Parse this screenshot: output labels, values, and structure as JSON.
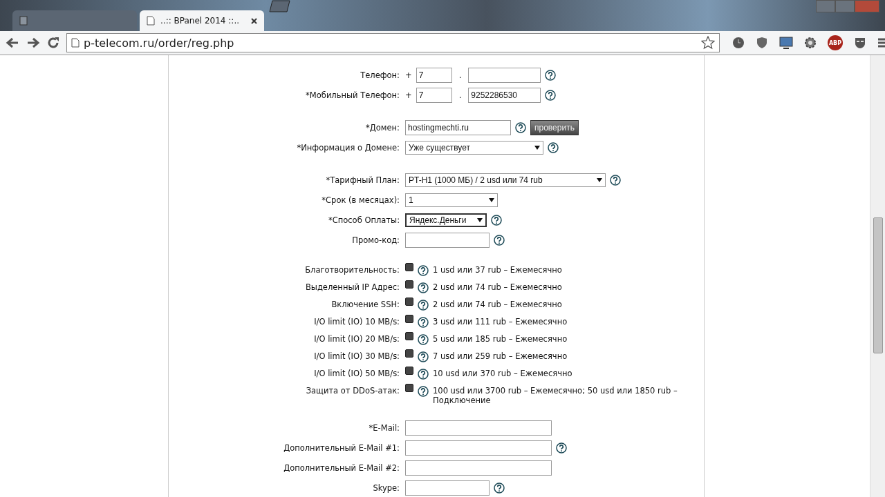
{
  "browser": {
    "tabs": [
      {
        "selected": false
      },
      {
        "title": "..:: BPanel 2014 ::..",
        "selected": true
      }
    ],
    "address": "p-telecom.ru/order/reg.php",
    "bookmarked": false,
    "adblock_label": "ABP"
  },
  "form": {
    "groups": [
      [
        {
          "kind": "phone",
          "label": "Телефон:",
          "prefix": "+",
          "code": "7",
          "separator": ".",
          "help": true
        },
        {
          "kind": "phone",
          "label": "*Мобильный Телефон:",
          "prefix": "+",
          "code": "7",
          "separator": ".",
          "number": "9252286530",
          "help": true
        }
      ],
      [
        {
          "kind": "text_button",
          "label": "*Домен:",
          "value": "hostingmechti.ru",
          "button": "проверить",
          "help": true
        },
        {
          "kind": "select",
          "label": "*Информация о Домене:",
          "value": "Уже существует",
          "focused": false,
          "help": true
        }
      ],
      [
        {
          "kind": "select",
          "label": "*Тарифный План:",
          "value": "PT-H1 (1000 МБ) / 2 usd или 74 rub",
          "focused": false,
          "help": true
        },
        {
          "kind": "select",
          "label": "*Срок (в месяцах):",
          "value": "1",
          "focused": false,
          "help": false
        },
        {
          "kind": "select",
          "label": "*Способ Оплаты:",
          "value": "Яндекс.Деньги",
          "focused": true,
          "help": true
        },
        {
          "kind": "text",
          "label": "Промо-код:",
          "help": true
        }
      ],
      [
        {
          "kind": "option",
          "label": "Благотворительность:",
          "checked": false,
          "price": "1 usd или 37 rub – Ежемесячно",
          "help": true
        },
        {
          "kind": "option",
          "label": "Выделенный IP Адрес:",
          "checked": false,
          "price": "2 usd или 74 rub – Ежемесячно",
          "help": true
        },
        {
          "kind": "option",
          "label": "Включение SSH:",
          "checked": false,
          "price": "2 usd или 74 rub – Ежемесячно",
          "help": true
        },
        {
          "kind": "option",
          "label": "I/O limit (IO) 10 MB/s:",
          "checked": false,
          "price": "3 usd или 111 rub – Ежемесячно",
          "help": true
        },
        {
          "kind": "option",
          "label": "I/O limit (IO) 20 MB/s:",
          "checked": false,
          "price": "5 usd или 185 rub – Ежемесячно",
          "help": true
        },
        {
          "kind": "option",
          "label": "I/O limit (IO) 30 MB/s:",
          "checked": false,
          "price": "7 usd или 259 rub – Ежемесячно",
          "help": true
        },
        {
          "kind": "option",
          "label": "I/O limit (IO) 50 MB/s:",
          "checked": false,
          "price": "10 usd или 370 rub – Ежемесячно",
          "help": true
        },
        {
          "kind": "option",
          "label": "Защита от DDoS-атак:",
          "checked": false,
          "price": "100 usd или 3700 rub – Ежемесячно; 50 usd или 1850 rub – Подключение",
          "help": true
        }
      ],
      [
        {
          "kind": "text",
          "label": "*E-Mail:",
          "help": false
        },
        {
          "kind": "text",
          "label": "Дополнительный E-Mail #1:",
          "help": true
        },
        {
          "kind": "text",
          "label": "Дополнительный E-Mail #2:",
          "help": false
        },
        {
          "kind": "text",
          "label": "Skype:",
          "help": true
        }
      ]
    ]
  }
}
